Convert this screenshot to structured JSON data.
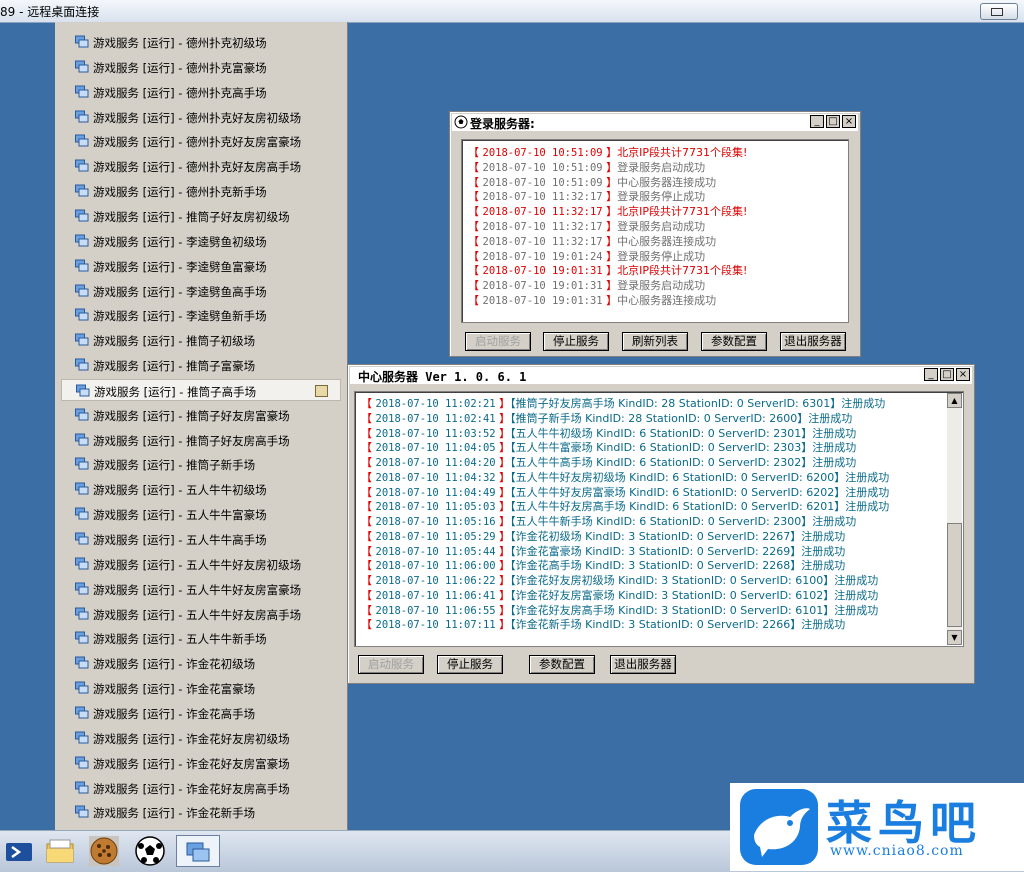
{
  "window": {
    "title": "89 - 远程桌面连接"
  },
  "menu": {
    "items": [
      "游戏服务 [运行] - 德州扑克初级场",
      "游戏服务 [运行] - 德州扑克富豪场",
      "游戏服务 [运行] - 德州扑克高手场",
      "游戏服务 [运行] - 德州扑克好友房初级场",
      "游戏服务 [运行] - 德州扑克好友房富豪场",
      "游戏服务 [运行] - 德州扑克好友房高手场",
      "游戏服务 [运行] - 德州扑克新手场",
      "游戏服务 [运行] - 推筒子好友房初级场",
      "游戏服务 [运行] - 李逵劈鱼初级场",
      "游戏服务 [运行] - 李逵劈鱼富豪场",
      "游戏服务 [运行] - 李逵劈鱼高手场",
      "游戏服务 [运行] - 李逵劈鱼新手场",
      "游戏服务 [运行] - 推筒子初级场",
      "游戏服务 [运行] - 推筒子富豪场",
      "游戏服务 [运行] - 推筒子高手场",
      "游戏服务 [运行] - 推筒子好友房富豪场",
      "游戏服务 [运行] - 推筒子好友房高手场",
      "游戏服务 [运行] - 推筒子新手场",
      "游戏服务 [运行] - 五人牛牛初级场",
      "游戏服务 [运行] - 五人牛牛富豪场",
      "游戏服务 [运行] - 五人牛牛高手场",
      "游戏服务 [运行] - 五人牛牛好友房初级场",
      "游戏服务 [运行] - 五人牛牛好友房富豪场",
      "游戏服务 [运行] - 五人牛牛好友房高手场",
      "游戏服务 [运行] - 五人牛牛新手场",
      "游戏服务 [运行] - 诈金花初级场",
      "游戏服务 [运行] - 诈金花富豪场",
      "游戏服务 [运行] - 诈金花高手场",
      "游戏服务 [运行] - 诈金花好友房初级场",
      "游戏服务 [运行] - 诈金花好友房富豪场",
      "游戏服务 [运行] - 诈金花好友房高手场",
      "游戏服务 [运行] - 诈金花新手场"
    ]
  },
  "login_window": {
    "title": "登录服务器:",
    "controls": {
      "min": "_",
      "max": "□",
      "close": "×"
    },
    "log": [
      {
        "ts": "2018-07-10 10:51:09",
        "msg": "北京IP段共计7731个段集!",
        "level": "error"
      },
      {
        "ts": "2018-07-10 10:51:09",
        "msg": "登录服务启动成功",
        "level": "info"
      },
      {
        "ts": "2018-07-10 10:51:09",
        "msg": "中心服务器连接成功",
        "level": "info"
      },
      {
        "ts": "2018-07-10 11:32:17",
        "msg": "登录服务停止成功",
        "level": "info"
      },
      {
        "ts": "2018-07-10 11:32:17",
        "msg": "北京IP段共计7731个段集!",
        "level": "error"
      },
      {
        "ts": "2018-07-10 11:32:17",
        "msg": "登录服务启动成功",
        "level": "info"
      },
      {
        "ts": "2018-07-10 11:32:17",
        "msg": "中心服务器连接成功",
        "level": "info"
      },
      {
        "ts": "2018-07-10 19:01:24",
        "msg": "登录服务停止成功",
        "level": "info"
      },
      {
        "ts": "2018-07-10 19:01:31",
        "msg": "北京IP段共计7731个段集!",
        "level": "error"
      },
      {
        "ts": "2018-07-10 19:01:31",
        "msg": "登录服务启动成功",
        "level": "info"
      },
      {
        "ts": "2018-07-10 19:01:31",
        "msg": "中心服务器连接成功",
        "level": "info"
      }
    ],
    "buttons": {
      "start": "启动服务",
      "stop": "停止服务",
      "refresh": "刷新列表",
      "config": "参数配置",
      "exit": "退出服务器"
    }
  },
  "center_window": {
    "title": "中心服务器 Ver 1. 0. 6. 1",
    "controls": {
      "min": "_",
      "max": "□",
      "close": "×"
    },
    "log": [
      {
        "ts": "2018-07-10 11:02:21",
        "msg": "【推筒子好友房高手场  KindID: 28 StationID: 0  ServerID: 6301】注册成功"
      },
      {
        "ts": "2018-07-10 11:02:41",
        "msg": "【推筒子新手场  KindID: 28 StationID: 0  ServerID: 2600】注册成功"
      },
      {
        "ts": "2018-07-10 11:03:52",
        "msg": "【五人牛牛初级场  KindID: 6 StationID: 0  ServerID: 2301】注册成功"
      },
      {
        "ts": "2018-07-10 11:04:05",
        "msg": "【五人牛牛富豪场  KindID: 6 StationID: 0  ServerID: 2303】注册成功"
      },
      {
        "ts": "2018-07-10 11:04:20",
        "msg": "【五人牛牛高手场  KindID: 6 StationID: 0  ServerID: 2302】注册成功"
      },
      {
        "ts": "2018-07-10 11:04:32",
        "msg": "【五人牛牛好友房初级场  KindID: 6 StationID: 0  ServerID: 6200】注册成功"
      },
      {
        "ts": "2018-07-10 11:04:49",
        "msg": "【五人牛牛好友房富豪场  KindID: 6 StationID: 0  ServerID: 6202】注册成功"
      },
      {
        "ts": "2018-07-10 11:05:03",
        "msg": "【五人牛牛好友房高手场  KindID: 6 StationID: 0  ServerID: 6201】注册成功"
      },
      {
        "ts": "2018-07-10 11:05:16",
        "msg": "【五人牛牛新手场  KindID: 6 StationID: 0  ServerID: 2300】注册成功"
      },
      {
        "ts": "2018-07-10 11:05:29",
        "msg": "【诈金花初级场  KindID: 3 StationID: 0  ServerID: 2267】注册成功"
      },
      {
        "ts": "2018-07-10 11:05:44",
        "msg": "【诈金花富豪场  KindID: 3 StationID: 0  ServerID: 2269】注册成功"
      },
      {
        "ts": "2018-07-10 11:06:00",
        "msg": "【诈金花高手场  KindID: 3 StationID: 0  ServerID: 2268】注册成功"
      },
      {
        "ts": "2018-07-10 11:06:22",
        "msg": "【诈金花好友房初级场  KindID: 3 StationID: 0  ServerID: 6100】注册成功"
      },
      {
        "ts": "2018-07-10 11:06:41",
        "msg": "【诈金花好友房富豪场  KindID: 3 StationID: 0  ServerID: 6102】注册成功"
      },
      {
        "ts": "2018-07-10 11:06:55",
        "msg": "【诈金花好友房高手场  KindID: 3 StationID: 0  ServerID: 6101】注册成功"
      },
      {
        "ts": "2018-07-10 11:07:11",
        "msg": "【诈金花新手场  KindID: 3 StationID: 0  ServerID: 2266】注册成功"
      }
    ],
    "buttons": {
      "start": "启动服务",
      "stop": "停止服务",
      "config": "参数配置",
      "exit": "退出服务器"
    }
  },
  "watermark": {
    "brand": "菜鸟吧",
    "url": "www.cniao8.com"
  },
  "colors": {
    "desktop": "#3a6ea5",
    "error": "#e00000",
    "info": "#707070",
    "center_text": "#0a6a8a",
    "bracket": "#e00000"
  }
}
